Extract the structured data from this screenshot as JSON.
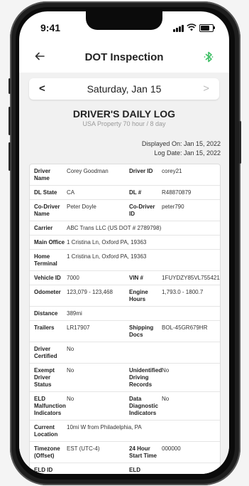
{
  "status_bar": {
    "time": "9:41"
  },
  "header": {
    "back_icon": "arrow-left-icon",
    "title": "DOT Inspection",
    "bt_icon": "bluetooth-icon",
    "bt_color": "#3fbf66"
  },
  "date_nav": {
    "prev": "<",
    "date": "Saturday, Jan 15",
    "next": ">"
  },
  "log": {
    "title": "DRIVER'S DAILY LOG",
    "subtitle": "USA Property 70 hour / 8 day",
    "displayed_on": "Displayed On: Jan 15, 2022",
    "log_date": "Log Date: Jan 15, 2022"
  },
  "rows": [
    {
      "l1": "Driver Name",
      "v1": "Corey Goodman",
      "l2": "Driver ID",
      "v2": "corey21"
    },
    {
      "l1": "DL State",
      "v1": "CA",
      "l2": "DL #",
      "v2": "R48870879"
    },
    {
      "l1": "Co-Driver Name",
      "v1": "Peter Doyle",
      "l2": "Co-Driver ID",
      "v2": "peter790"
    },
    {
      "l1": "Carrier",
      "v1": "ABC Trans LLC (US DOT # 2789798)"
    },
    {
      "l1": "Main Office",
      "v1": "1 Cristina Ln, Oxford PA, 19363"
    },
    {
      "l1": "Home Terminal",
      "v1": "1 Cristina Ln, Oxford PA, 19363"
    },
    {
      "l1": "Vehicle ID",
      "v1": "7000",
      "l2": "VIN #",
      "v2": "1FUYDZY85VL755421"
    },
    {
      "l1": "Odometer",
      "v1": "123,079 - 123,468",
      "l2": "Engine Hours",
      "v2": "1,793.0 - 1800.7"
    },
    {
      "l1": "Distance",
      "v1": "389mi"
    },
    {
      "l1": "Trailers",
      "v1": "LR17907",
      "l2": "Shipping Docs",
      "v2": "BOL-45GR679HR"
    },
    {
      "l1": "Driver Certified",
      "v1": "No"
    },
    {
      "l1": "Exempt Driver Status",
      "v1": "No",
      "l2": "Unidentified Driving Records",
      "v2": "No"
    },
    {
      "l1": "ELD Malfunction Indicators",
      "v1": "No",
      "l2": "Data Diagnostic Indicators",
      "v2": "No"
    },
    {
      "l1": "Current Location",
      "v1": "10mi W from Philadelphia, PA"
    },
    {
      "l1": "Timezone (Offset)",
      "v1": "EST (UTC-4)",
      "l2": "24 Hour Start Time",
      "v2": "000000"
    },
    {
      "l1": "ELD ID",
      "v1": "",
      "l2": "ELD Provider",
      "v2": ""
    }
  ]
}
